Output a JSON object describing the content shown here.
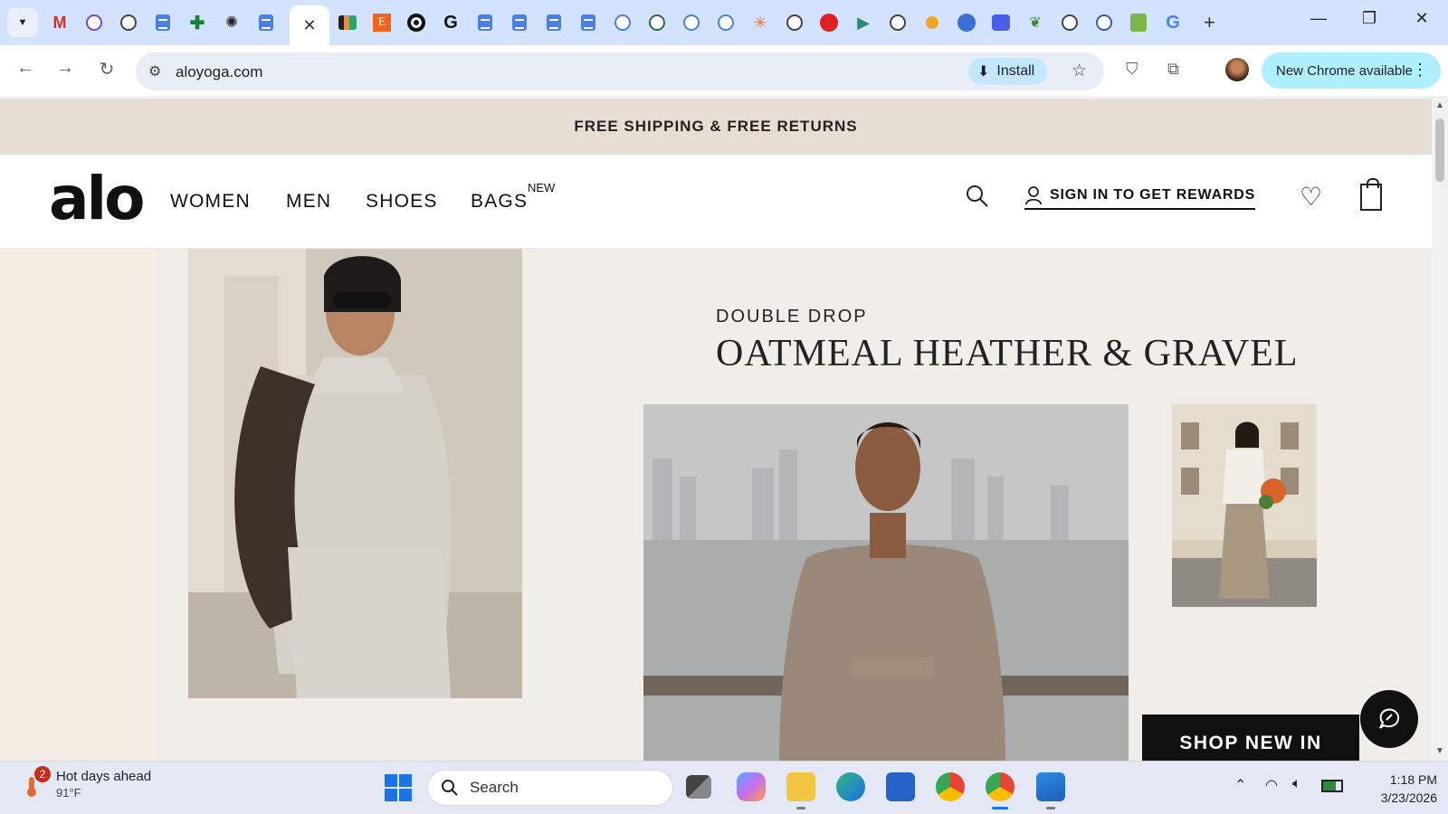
{
  "browser": {
    "url": "aloyoga.com",
    "install_label": "Install",
    "update_label": "New Chrome available",
    "active_tab_close": "✕",
    "new_tab": "+"
  },
  "site": {
    "announcement": "FREE SHIPPING & FREE RETURNS",
    "logo": "alo",
    "nav": {
      "women": "WOMEN",
      "men": "MEN",
      "shoes": "SHOES",
      "bags": "BAGS",
      "bags_badge": "NEW"
    },
    "rewards": "SIGN IN TO GET REWARDS"
  },
  "hero": {
    "eyebrow": "DOUBLE DROP",
    "headline": "OATMEAL HEATHER & GRAVEL",
    "cta": "SHOP NEW IN"
  },
  "taskbar": {
    "weather_title": "Hot days ahead",
    "weather_temp": "91°F",
    "weather_badge": "2",
    "search_placeholder": "Search",
    "time": "1:18 PM",
    "date": "3/23/2026"
  },
  "colors": {
    "tabstrip": "#d3e3fd",
    "announcement_bg": "#e6ded4",
    "hero_bg": "#f1eee9",
    "cta_bg": "#111111",
    "update_chip": "#aef0ff"
  }
}
